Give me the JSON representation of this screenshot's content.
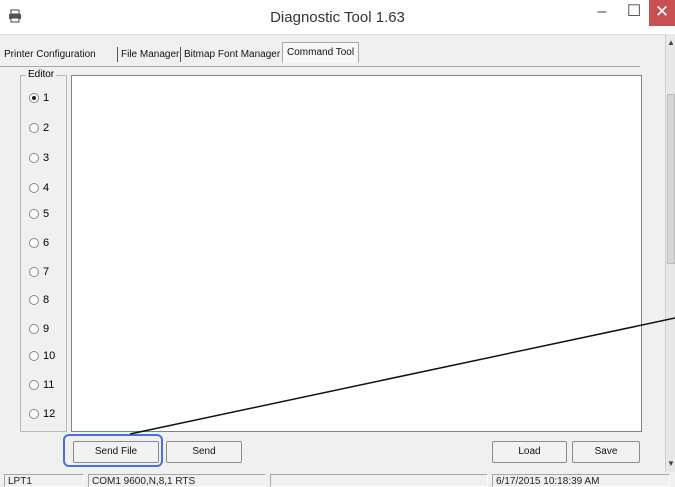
{
  "window": {
    "title": "Diagnostic Tool 1.63",
    "minimize": "–",
    "maximize": "☐",
    "close": "✕"
  },
  "tabs": [
    {
      "label": "Printer Configuration",
      "active": false
    },
    {
      "label": "File Manager",
      "active": false
    },
    {
      "label": "Bitmap Font Manager",
      "active": false
    },
    {
      "label": "Command Tool",
      "active": true
    }
  ],
  "editor": {
    "legend": "Editor",
    "selected": "1",
    "options": [
      "1",
      "2",
      "3",
      "4",
      "5",
      "6",
      "7",
      "8",
      "9",
      "10",
      "11",
      "12"
    ],
    "content": ""
  },
  "buttons": {
    "send_file": "Send File",
    "send": "Send",
    "load": "Load",
    "save": "Save"
  },
  "status": {
    "port": "LPT1",
    "com_settings": "COM1 9600,N,8,1 RTS",
    "message": "",
    "datetime": "6/17/2015 10:18:39 AM"
  },
  "colors": {
    "highlight": "#4a6fe3",
    "close_button": "#c75050"
  }
}
